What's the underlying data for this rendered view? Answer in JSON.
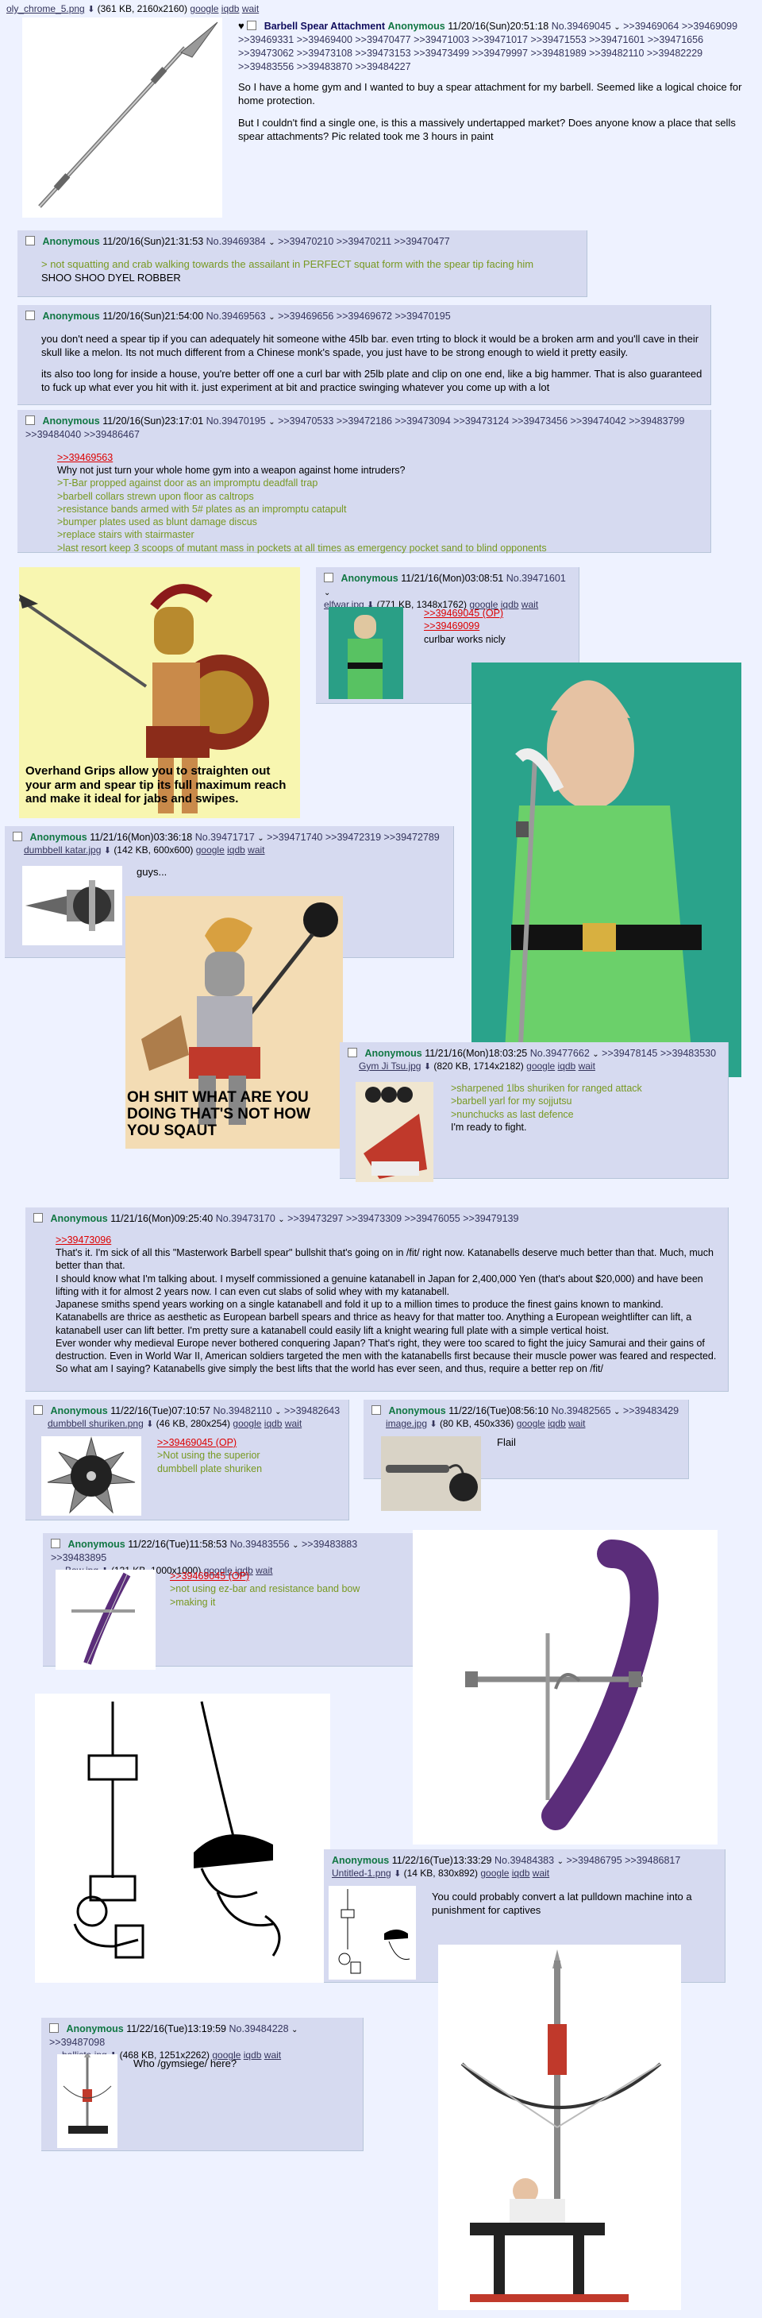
{
  "op": {
    "filename": "oly_chrome_5.png",
    "filesize": "(361 KB, 2160x2160)",
    "links": [
      "google",
      "iqdb",
      "wait"
    ],
    "subject": "Barbell Spear Attachment",
    "name": "Anonymous",
    "datetime": "11/20/16(Sun)20:51:18",
    "postno": "No.39469045",
    "replies": ">>39469064 >>39469099 >>39469331 >>39469400 >>39470477 >>39471003 >>39471017 >>39471553 >>39471601 >>39471656 >>39473062 >>39473108 >>39473153 >>39473499 >>39479997 >>39481989 >>39482110 >>39482229 >>39483556 >>39483870 >>39484227",
    "p1": "So I have a home gym and I wanted to buy a spear attachment for my barbell. Seemed like a logical choice for home protection.",
    "p2": "But I couldn't find a single one, is this a massively undertapped market? Does anyone know a place that sells spear attachments? Pic related took me 3 hours in paint"
  },
  "posts": [
    {
      "name": "Anonymous",
      "datetime": "11/20/16(Sun)21:31:53",
      "postno": "No.39469384",
      "replies": ">>39470210 >>39470211 >>39470477",
      "greentext": "> not squatting and crab walking towards the assailant in PERFECT squat form with the spear tip facing him",
      "text": "SHOO SHOO DYEL ROBBER"
    },
    {
      "name": "Anonymous",
      "datetime": "11/20/16(Sun)21:54:00",
      "postno": "No.39469563",
      "replies": ">>39469656 >>39469672 >>39470195",
      "p1": "you don't need a spear tip if you can adequately hit someone withe 45lb bar. even trting to block it would be a broken arm and you'll cave in their skull like a melon. Its not much different from a Chinese monk's spade, you just have to be strong enough to wield it pretty easily.",
      "p2": "its also too long for inside a house, you're better off one a curl bar with 25lb plate and clip on one end, like a big hammer. That is also guaranteed to fuck up what ever you hit with it. just experiment at bit and practice swinging whatever you come up with a lot"
    },
    {
      "name": "Anonymous",
      "datetime": "11/20/16(Sun)23:17:01",
      "postno": "No.39470195",
      "replies": ">>39470533 >>39472186 >>39473094 >>39473124 >>39473456 >>39474042 >>39483799 >>39484040 >>39486467",
      "quote": ">>39469563",
      "text": "Why not just turn your whole home gym into a weapon against home intruders?",
      "green": [
        ">T-Bar propped against door as an impromptu deadfall trap",
        ">barbell collars strewn upon floor as caltrops",
        ">resistance bands armed with 5# plates as an impromptu catapult",
        ">bumper plates used as blunt damage discus",
        ">replace stairs with stairmaster",
        ">last resort keep 3 scoops of mutant mass in pockets at all times as emergency pocket sand to blind opponents"
      ]
    }
  ],
  "spartan_caption": "Overhand Grips allow you to straighten out your arm and spear tip its full maximum reach and make it ideal for jabs and swipes.",
  "elfwar": {
    "name": "Anonymous",
    "datetime": "11/21/16(Mon)03:08:51",
    "postno": "No.39471601",
    "filename": "elfwar.jpg",
    "filesize": "(771 KB, 1348x1762)",
    "links": [
      "google",
      "iqdb",
      "wait"
    ],
    "quote1": ">>39469045 (OP)",
    "quote2": ">>39469099",
    "text": "curlbar works nicly"
  },
  "katar": {
    "name": "Anonymous",
    "datetime": "11/21/16(Mon)03:36:18",
    "postno": "No.39471717",
    "replies": ">>39471740 >>39472319 >>39472789",
    "filename": "dumbbell katar.jpg",
    "filesize": "(142 KB, 600x600)",
    "links": [
      "google",
      "iqdb",
      "wait"
    ],
    "text": "guys..."
  },
  "knight_caption": "OH SHIT WHAT ARE YOU DOING THAT'S NOT HOW YOU SQAUT",
  "jitsu": {
    "name": "Anonymous",
    "datetime": "11/21/16(Mon)18:03:25",
    "postno": "No.39477662",
    "replies": ">>39478145 >>39483530",
    "filename": "Gym Ji Tsu.jpg",
    "filesize": "(820 KB, 1714x2182)",
    "links": [
      "google",
      "iqdb",
      "wait"
    ],
    "green": [
      ">sharpened 1lbs shuriken for ranged attack",
      ">barbell yarl for my sojjutsu",
      ">nunchucks as last defence"
    ],
    "text": "I'm ready to fight."
  },
  "katana": {
    "name": "Anonymous",
    "datetime": "11/21/16(Mon)09:25:40",
    "postno": "No.39473170",
    "replies": ">>39473297 >>39473309 >>39476055 >>39479139",
    "quote": ">>39473096",
    "lines": [
      "That's it. I'm sick of all this \"Masterwork Barbell spear\" bullshit that's going on in /fit/ right now. Katanabells deserve much better than that. Much, much better than that.",
      "I should know what I'm talking about. I myself commissioned a genuine katanabell in Japan for 2,400,000 Yen (that's about $20,000) and have been lifting with it for almost 2 years now. I can even cut slabs of solid whey with my katanabell.",
      "Japanese smiths spend years working on a single katanabell and fold it up to a million times to produce the finest gains known to mankind.",
      "Katanabells are thrice as aesthetic as European barbell spears and thrice as heavy for that matter too. Anything a European weightlifter can lift, a katanabell user can lift better. I'm pretty sure a katanabell could easily lift a knight wearing full plate with a simple vertical hoist.",
      "Ever wonder why medieval Europe never bothered conquering Japan? That's right, they were too scared to fight the juicy Samurai and their gains of destruction. Even in World War II, American soldiers targeted the men with the katanabells first because their muscle power was feared and respected.",
      "So what am I saying? Katanabells give simply the best lifts that the world has ever seen, and thus, require a better rep on /fit/"
    ]
  },
  "shuriken": {
    "name": "Anonymous",
    "datetime": "11/22/16(Tue)07:10:57",
    "postno": "No.39482110",
    "replies": ">>39482643",
    "filename": "dumbbell shuriken.png",
    "filesize": "(46 KB, 280x254)",
    "links": [
      "google",
      "iqdb",
      "wait"
    ],
    "quote": ">>39469045 (OP)",
    "green": [
      ">Not using the superior",
      "dumbbell plate shuriken"
    ]
  },
  "flail": {
    "name": "Anonymous",
    "datetime": "11/22/16(Tue)08:56:10",
    "postno": "No.39482565",
    "replies": ">>39483429",
    "filename": "image.jpg",
    "filesize": "(80 KB, 450x336)",
    "links": [
      "google",
      "iqdb",
      "wait"
    ],
    "text": "Flail"
  },
  "bow": {
    "name": "Anonymous",
    "datetime": "11/22/16(Tue)11:58:53",
    "postno": "No.39483556",
    "replies": ">>39483883 >>39483895",
    "filename": "Bow.jpg",
    "filesize": "(131 KB, 1000x1000)",
    "links": [
      "google",
      "iqdb",
      "wait"
    ],
    "quote": ">>39469045 (OP)",
    "green": [
      ">not using ez-bar and resistance band bow",
      ">making it"
    ]
  },
  "pulldown": {
    "name": "Anonymous",
    "datetime": "11/22/16(Tue)13:33:29",
    "postno": "No.39484383",
    "replies": ">>39486795 >>39486817",
    "filename": "Untitled-1.png",
    "filesize": "(14 KB, 830x892)",
    "links": [
      "google",
      "iqdb",
      "wait"
    ],
    "text": "You could probably convert a lat pulldown machine into a punishment for captives"
  },
  "ballista": {
    "name": "Anonymous",
    "datetime": "11/22/16(Tue)13:19:59",
    "postno": "No.39484228",
    "replies": ">>39487098",
    "filename": "ballista.jpg",
    "filesize": "(468 KB, 1251x2262)",
    "links": [
      "google",
      "iqdb",
      "wait"
    ],
    "text": "Who /gymsiege/ here?"
  },
  "colors": {
    "bg": "#eef2ff",
    "post_bg": "#d6daf0",
    "name_green": "#117743",
    "subject_blue": "#0f0c5d",
    "greentext": "#789922",
    "quote_red": "#dd0000",
    "link": "#34345c"
  }
}
